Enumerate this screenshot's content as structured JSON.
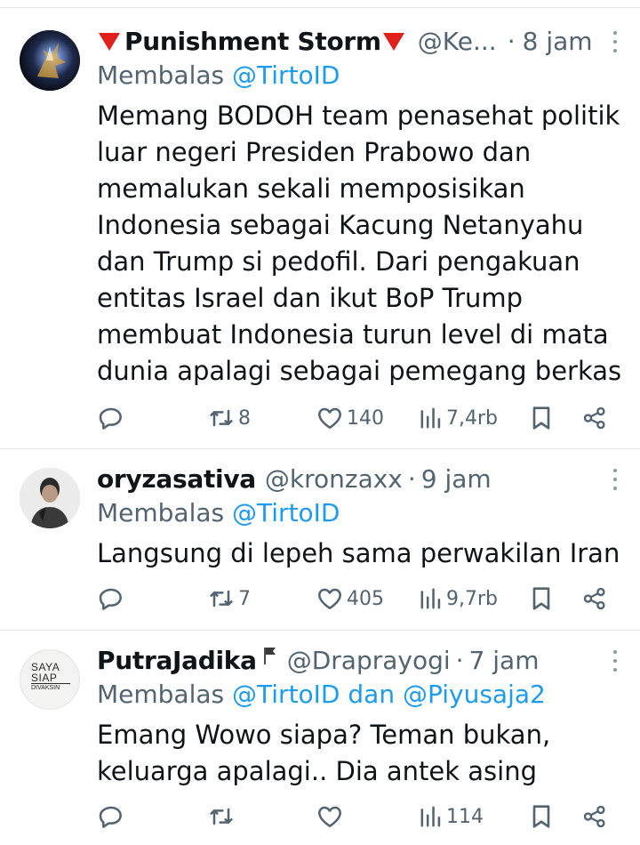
{
  "tweets": [
    {
      "name": "Punishment Storm",
      "handle": "@Ke...",
      "time": "8 jam",
      "reply_prefix": "Membalas",
      "reply_to": "@TirtoID",
      "body": "Memang BODOH team penasehat politik luar negeri Presiden Prabowo dan memalukan sekali memposisikan Indonesia sebagai Kacung Netanyahu dan Trump si pedofil. Dari pengakuan entitas Israel dan ikut BoP Trump membuat Indonesia turun level di mata dunia apalagi sebagai pemegang berkas",
      "replies": "",
      "retweets": "8",
      "likes": "140",
      "views": "7,4rb"
    },
    {
      "name": "oryzasativa",
      "handle": "@kronzaxx",
      "time": "9 jam",
      "reply_prefix": "Membalas",
      "reply_to": "@TirtoID",
      "body": "Langsung di lepeh sama perwakilan Iran",
      "replies": "",
      "retweets": "7",
      "likes": "405",
      "views": "9,7rb"
    },
    {
      "name": "PutraJadika",
      "handle": "@Draprayogi",
      "time": "7 jam",
      "reply_prefix": "Membalas",
      "reply_to": "@TirtoID dan @Piyusaja2",
      "body": "Emang Wowo siapa? Teman bukan, keluarga apalagi.. Dia antek asing",
      "replies": "",
      "retweets": "",
      "likes": "",
      "views": "114",
      "avatar_text": [
        "SAYA",
        "SIAP",
        "DIVAKSIN"
      ]
    }
  ],
  "icons": {
    "reply": "reply-icon",
    "retweet": "retweet-icon",
    "like": "heart-icon",
    "views": "views-icon",
    "bookmark": "bookmark-icon",
    "share": "share-icon",
    "more": "more-icon",
    "name_decoration": "red-triangle-icon",
    "name_flag": "flag-icon"
  },
  "colors": {
    "text": "#0f1419",
    "secondary": "#536471",
    "mention": "#1d9bf0",
    "triangle": "#e0211b",
    "divider": "#e3e6e8"
  }
}
